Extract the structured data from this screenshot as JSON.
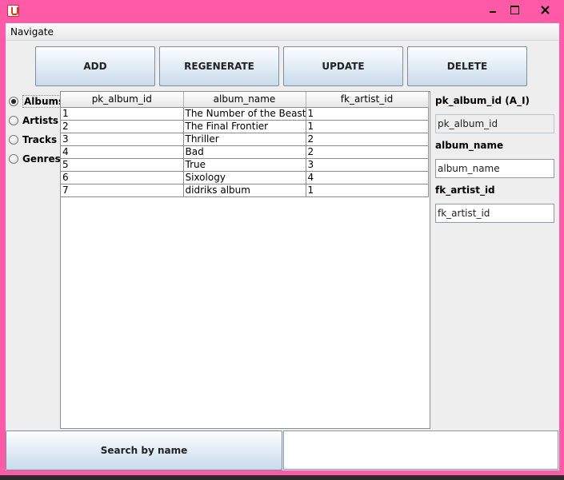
{
  "window": {
    "minimize": "minimize",
    "maximize": "maximize",
    "close": "close"
  },
  "menubar": {
    "items": [
      "Navigate"
    ]
  },
  "toolbar": {
    "add": "ADD",
    "regenerate": "REGENERATE",
    "update": "UPDATE",
    "delete": "DELETE"
  },
  "nav": {
    "options": [
      "Albums",
      "Artists",
      "Tracks",
      "Genres"
    ],
    "selected": "Albums"
  },
  "table": {
    "columns": [
      "pk_album_id",
      "album_name",
      "fk_artist_id"
    ],
    "rows": [
      [
        "1",
        "The Number of the Beast",
        "1"
      ],
      [
        "2",
        "The Final Frontier",
        "1"
      ],
      [
        "3",
        "Thriller",
        "2"
      ],
      [
        "4",
        "Bad",
        "2"
      ],
      [
        "5",
        "True",
        "3"
      ],
      [
        "6",
        "Sixology",
        "4"
      ],
      [
        "7",
        "didriks album",
        "1"
      ]
    ]
  },
  "form": {
    "pk_label": "pk_album_id (A_I)",
    "pk_value": "pk_album_id",
    "name_label": "album_name",
    "name_value": "album_name",
    "fk_label": "fk_artist_id",
    "fk_value": "fk_artist_id"
  },
  "search": {
    "button_label": "Search by name",
    "value": ""
  }
}
